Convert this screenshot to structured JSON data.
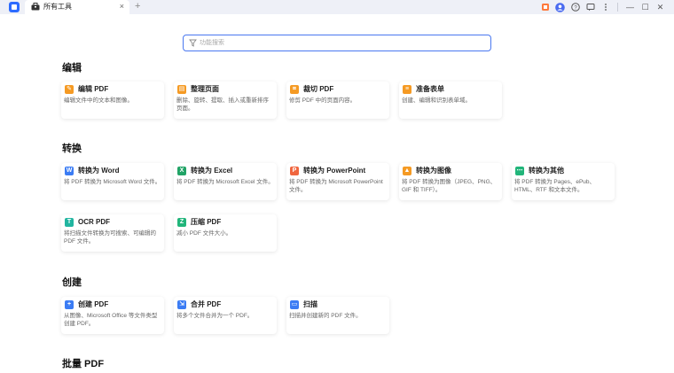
{
  "tab": {
    "label": "所有工具",
    "close": "×",
    "add": "+"
  },
  "titlebar": {
    "minimize": "—",
    "maximize": "☐",
    "close": "✕"
  },
  "search": {
    "placeholder": "功能搜索"
  },
  "sections": [
    {
      "title": "编辑",
      "cards": [
        {
          "title": "编辑 PDF",
          "desc": "编辑文件中的文本和图像。",
          "color": "#f59a23"
        },
        {
          "title": "整理页面",
          "desc": "删除、旋转、提取、插入或重新排序页面。",
          "color": "#f59a23"
        },
        {
          "title": "裁切 PDF",
          "desc": "修剪 PDF 中的页面内容。",
          "color": "#f59a23"
        },
        {
          "title": "准备表单",
          "desc": "创建、编辑和识别表单域。",
          "color": "#f59a23"
        }
      ]
    },
    {
      "title": "转换",
      "cards": [
        {
          "title": "转换为 Word",
          "desc": "将 PDF 转换为 Microsoft Word 文件。",
          "color": "#3b7cf4"
        },
        {
          "title": "转换为 Excel",
          "desc": "将 PDF 转换为 Microsoft Excel 文件。",
          "color": "#21a366"
        },
        {
          "title": "转换为 PowerPoint",
          "desc": "将 PDF 转换为 Microsoft PowerPoint 文件。",
          "color": "#f0663f"
        },
        {
          "title": "转换为图像",
          "desc": "将 PDF 转换为图像（JPEG、PNG、GIF 和 TIFF）。",
          "color": "#f59a23"
        },
        {
          "title": "转换为其他",
          "desc": "将 PDF 转换为 Pages、ePub、HTML、RTF 和文本文件。",
          "color": "#21b57a"
        },
        {
          "title": "OCR PDF",
          "desc": "将扫描文件转换为可搜索、可编辑的 PDF 文件。",
          "color": "#21b5a0"
        },
        {
          "title": "压缩 PDF",
          "desc": "减小 PDF 文件大小。",
          "color": "#21b57a"
        }
      ]
    },
    {
      "title": "创建",
      "cards": [
        {
          "title": "创建 PDF",
          "desc": "从图像、Microsoft Office 等文件类型创建 PDF。",
          "color": "#3b7cf4"
        },
        {
          "title": "合并 PDF",
          "desc": "将多个文件合并为一个 PDF。",
          "color": "#3b7cf4"
        },
        {
          "title": "扫描",
          "desc": "扫描并创建新的 PDF 文件。",
          "color": "#3b7cf4"
        }
      ]
    },
    {
      "title": "批量 PDF",
      "cards": []
    }
  ],
  "icons": {
    "s0c0": "pencil-icon",
    "s0c1": "pages-icon",
    "s0c2": "crop-icon",
    "s0c3": "form-icon",
    "s1c0": "word-icon",
    "s1c1": "excel-icon",
    "s1c2": "powerpoint-icon",
    "s1c3": "image-icon",
    "s1c4": "more-formats-icon",
    "s1c5": "ocr-icon",
    "s1c6": "compress-icon",
    "s2c0": "plus-icon",
    "s2c1": "merge-icon",
    "s2c2": "scan-icon"
  },
  "icon_glyphs": {
    "s0c0": "✎",
    "s0c1": "▤",
    "s0c2": "⌗",
    "s0c3": "≡",
    "s1c0": "W",
    "s1c1": "X",
    "s1c2": "P",
    "s1c3": "▲",
    "s1c4": "⋯",
    "s1c5": "T",
    "s1c6": "Z",
    "s2c0": "+",
    "s2c1": "⇲",
    "s2c2": "▭"
  }
}
